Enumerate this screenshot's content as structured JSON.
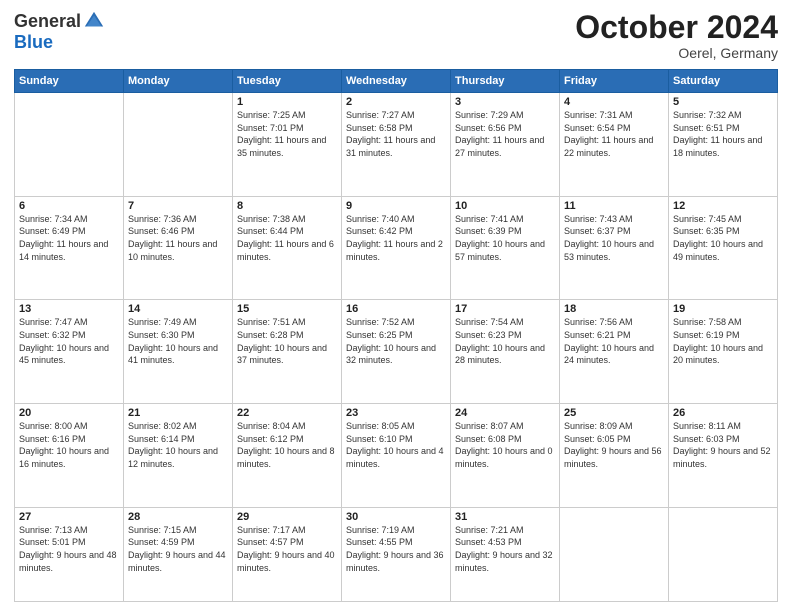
{
  "header": {
    "logo_general": "General",
    "logo_blue": "Blue",
    "month_title": "October 2024",
    "location": "Oerel, Germany"
  },
  "weekdays": [
    "Sunday",
    "Monday",
    "Tuesday",
    "Wednesday",
    "Thursday",
    "Friday",
    "Saturday"
  ],
  "weeks": [
    [
      {
        "day": "",
        "info": ""
      },
      {
        "day": "",
        "info": ""
      },
      {
        "day": "1",
        "info": "Sunrise: 7:25 AM\nSunset: 7:01 PM\nDaylight: 11 hours and 35 minutes."
      },
      {
        "day": "2",
        "info": "Sunrise: 7:27 AM\nSunset: 6:58 PM\nDaylight: 11 hours and 31 minutes."
      },
      {
        "day": "3",
        "info": "Sunrise: 7:29 AM\nSunset: 6:56 PM\nDaylight: 11 hours and 27 minutes."
      },
      {
        "day": "4",
        "info": "Sunrise: 7:31 AM\nSunset: 6:54 PM\nDaylight: 11 hours and 22 minutes."
      },
      {
        "day": "5",
        "info": "Sunrise: 7:32 AM\nSunset: 6:51 PM\nDaylight: 11 hours and 18 minutes."
      }
    ],
    [
      {
        "day": "6",
        "info": "Sunrise: 7:34 AM\nSunset: 6:49 PM\nDaylight: 11 hours and 14 minutes."
      },
      {
        "day": "7",
        "info": "Sunrise: 7:36 AM\nSunset: 6:46 PM\nDaylight: 11 hours and 10 minutes."
      },
      {
        "day": "8",
        "info": "Sunrise: 7:38 AM\nSunset: 6:44 PM\nDaylight: 11 hours and 6 minutes."
      },
      {
        "day": "9",
        "info": "Sunrise: 7:40 AM\nSunset: 6:42 PM\nDaylight: 11 hours and 2 minutes."
      },
      {
        "day": "10",
        "info": "Sunrise: 7:41 AM\nSunset: 6:39 PM\nDaylight: 10 hours and 57 minutes."
      },
      {
        "day": "11",
        "info": "Sunrise: 7:43 AM\nSunset: 6:37 PM\nDaylight: 10 hours and 53 minutes."
      },
      {
        "day": "12",
        "info": "Sunrise: 7:45 AM\nSunset: 6:35 PM\nDaylight: 10 hours and 49 minutes."
      }
    ],
    [
      {
        "day": "13",
        "info": "Sunrise: 7:47 AM\nSunset: 6:32 PM\nDaylight: 10 hours and 45 minutes."
      },
      {
        "day": "14",
        "info": "Sunrise: 7:49 AM\nSunset: 6:30 PM\nDaylight: 10 hours and 41 minutes."
      },
      {
        "day": "15",
        "info": "Sunrise: 7:51 AM\nSunset: 6:28 PM\nDaylight: 10 hours and 37 minutes."
      },
      {
        "day": "16",
        "info": "Sunrise: 7:52 AM\nSunset: 6:25 PM\nDaylight: 10 hours and 32 minutes."
      },
      {
        "day": "17",
        "info": "Sunrise: 7:54 AM\nSunset: 6:23 PM\nDaylight: 10 hours and 28 minutes."
      },
      {
        "day": "18",
        "info": "Sunrise: 7:56 AM\nSunset: 6:21 PM\nDaylight: 10 hours and 24 minutes."
      },
      {
        "day": "19",
        "info": "Sunrise: 7:58 AM\nSunset: 6:19 PM\nDaylight: 10 hours and 20 minutes."
      }
    ],
    [
      {
        "day": "20",
        "info": "Sunrise: 8:00 AM\nSunset: 6:16 PM\nDaylight: 10 hours and 16 minutes."
      },
      {
        "day": "21",
        "info": "Sunrise: 8:02 AM\nSunset: 6:14 PM\nDaylight: 10 hours and 12 minutes."
      },
      {
        "day": "22",
        "info": "Sunrise: 8:04 AM\nSunset: 6:12 PM\nDaylight: 10 hours and 8 minutes."
      },
      {
        "day": "23",
        "info": "Sunrise: 8:05 AM\nSunset: 6:10 PM\nDaylight: 10 hours and 4 minutes."
      },
      {
        "day": "24",
        "info": "Sunrise: 8:07 AM\nSunset: 6:08 PM\nDaylight: 10 hours and 0 minutes."
      },
      {
        "day": "25",
        "info": "Sunrise: 8:09 AM\nSunset: 6:05 PM\nDaylight: 9 hours and 56 minutes."
      },
      {
        "day": "26",
        "info": "Sunrise: 8:11 AM\nSunset: 6:03 PM\nDaylight: 9 hours and 52 minutes."
      }
    ],
    [
      {
        "day": "27",
        "info": "Sunrise: 7:13 AM\nSunset: 5:01 PM\nDaylight: 9 hours and 48 minutes."
      },
      {
        "day": "28",
        "info": "Sunrise: 7:15 AM\nSunset: 4:59 PM\nDaylight: 9 hours and 44 minutes."
      },
      {
        "day": "29",
        "info": "Sunrise: 7:17 AM\nSunset: 4:57 PM\nDaylight: 9 hours and 40 minutes."
      },
      {
        "day": "30",
        "info": "Sunrise: 7:19 AM\nSunset: 4:55 PM\nDaylight: 9 hours and 36 minutes."
      },
      {
        "day": "31",
        "info": "Sunrise: 7:21 AM\nSunset: 4:53 PM\nDaylight: 9 hours and 32 minutes."
      },
      {
        "day": "",
        "info": ""
      },
      {
        "day": "",
        "info": ""
      }
    ]
  ]
}
